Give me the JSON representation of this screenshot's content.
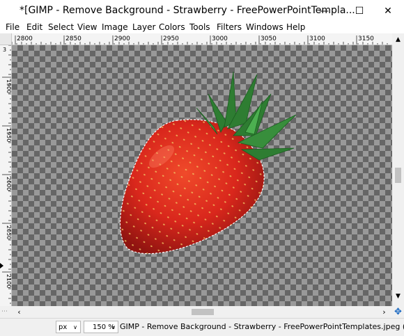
{
  "window": {
    "title": "*[GIMP - Remove Background - Strawberry - FreePowerPointTempla...",
    "minimize_label": "—",
    "maximize_label": "☐",
    "close_label": "✕"
  },
  "menu": {
    "items": [
      {
        "label": "File"
      },
      {
        "label": "Edit"
      },
      {
        "label": "Select"
      },
      {
        "label": "View"
      },
      {
        "label": "Image"
      },
      {
        "label": "Layer"
      },
      {
        "label": "Colors"
      },
      {
        "label": "Tools"
      },
      {
        "label": "Filters"
      },
      {
        "label": "Windows"
      },
      {
        "label": "Help"
      }
    ]
  },
  "rulers": {
    "horizontal_labels": [
      "2800",
      "2850",
      "2900",
      "2950",
      "3000",
      "3050",
      "3100",
      "3150"
    ],
    "vertical_labels": [
      "3",
      "1900",
      "1950",
      "2000",
      "2050",
      "2100"
    ]
  },
  "status": {
    "unit": "px",
    "zoom": "150 %",
    "text": "GIMP - Remove Background - Strawberry - FreePowerPointTemplates.jpeg (..."
  },
  "colors": {
    "checker_dark": "#666666",
    "checker_light": "#999999",
    "berry": "#d9271c",
    "leaf": "#2e7d32"
  }
}
